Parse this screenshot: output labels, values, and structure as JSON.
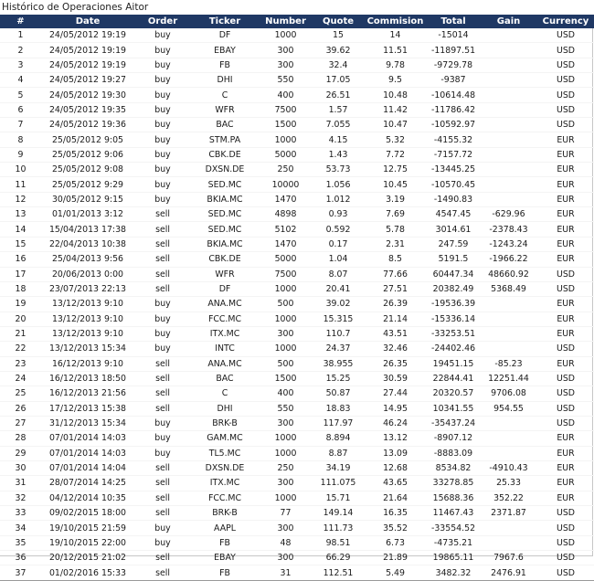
{
  "title": "Histórico de Operaciones Aitor",
  "columns": [
    "#",
    "Date",
    "Order",
    "Ticker",
    "Number",
    "Quote",
    "Commision",
    "Total",
    "Gain",
    "Currency"
  ],
  "rows": [
    [
      "1",
      "24/05/2012 19:19",
      "buy",
      "DF",
      "1000",
      "15",
      "14",
      "-15014",
      "",
      "USD"
    ],
    [
      "2",
      "24/05/2012 19:19",
      "buy",
      "EBAY",
      "300",
      "39.62",
      "11.51",
      "-11897.51",
      "",
      "USD"
    ],
    [
      "3",
      "24/05/2012 19:19",
      "buy",
      "FB",
      "300",
      "32.4",
      "9.78",
      "-9729.78",
      "",
      "USD"
    ],
    [
      "4",
      "24/05/2012 19:27",
      "buy",
      "DHI",
      "550",
      "17.05",
      "9.5",
      "-9387",
      "",
      "USD"
    ],
    [
      "5",
      "24/05/2012 19:30",
      "buy",
      "C",
      "400",
      "26.51",
      "10.48",
      "-10614.48",
      "",
      "USD"
    ],
    [
      "6",
      "24/05/2012 19:35",
      "buy",
      "WFR",
      "7500",
      "1.57",
      "11.42",
      "-11786.42",
      "",
      "USD"
    ],
    [
      "7",
      "24/05/2012 19:36",
      "buy",
      "BAC",
      "1500",
      "7.055",
      "10.47",
      "-10592.97",
      "",
      "USD"
    ],
    [
      "8",
      "25/05/2012 9:05",
      "buy",
      "STM.PA",
      "1000",
      "4.15",
      "5.32",
      "-4155.32",
      "",
      "EUR"
    ],
    [
      "9",
      "25/05/2012 9:06",
      "buy",
      "CBK.DE",
      "5000",
      "1.43",
      "7.72",
      "-7157.72",
      "",
      "EUR"
    ],
    [
      "10",
      "25/05/2012 9:08",
      "buy",
      "DXSN.DE",
      "250",
      "53.73",
      "12.75",
      "-13445.25",
      "",
      "EUR"
    ],
    [
      "11",
      "25/05/2012 9:29",
      "buy",
      "SED.MC",
      "10000",
      "1.056",
      "10.45",
      "-10570.45",
      "",
      "EUR"
    ],
    [
      "12",
      "30/05/2012 9:15",
      "buy",
      "BKIA.MC",
      "1470",
      "1.012",
      "3.19",
      "-1490.83",
      "",
      "EUR"
    ],
    [
      "13",
      "01/01/2013 3:12",
      "sell",
      "SED.MC",
      "4898",
      "0.93",
      "7.69",
      "4547.45",
      "-629.96",
      "EUR"
    ],
    [
      "14",
      "15/04/2013 17:38",
      "sell",
      "SED.MC",
      "5102",
      "0.592",
      "5.78",
      "3014.61",
      "-2378.43",
      "EUR"
    ],
    [
      "15",
      "22/04/2013 10:38",
      "sell",
      "BKIA.MC",
      "1470",
      "0.17",
      "2.31",
      "247.59",
      "-1243.24",
      "EUR"
    ],
    [
      "16",
      "25/04/2013 9:56",
      "sell",
      "CBK.DE",
      "5000",
      "1.04",
      "8.5",
      "5191.5",
      "-1966.22",
      "EUR"
    ],
    [
      "17",
      "20/06/2013 0:00",
      "sell",
      "WFR",
      "7500",
      "8.07",
      "77.66",
      "60447.34",
      "48660.92",
      "USD"
    ],
    [
      "18",
      "23/07/2013 22:13",
      "sell",
      "DF",
      "1000",
      "20.41",
      "27.51",
      "20382.49",
      "5368.49",
      "USD"
    ],
    [
      "19",
      "13/12/2013 9:10",
      "buy",
      "ANA.MC",
      "500",
      "39.02",
      "26.39",
      "-19536.39",
      "",
      "EUR"
    ],
    [
      "20",
      "13/12/2013 9:10",
      "buy",
      "FCC.MC",
      "1000",
      "15.315",
      "21.14",
      "-15336.14",
      "",
      "EUR"
    ],
    [
      "21",
      "13/12/2013 9:10",
      "buy",
      "ITX.MC",
      "300",
      "110.7",
      "43.51",
      "-33253.51",
      "",
      "EUR"
    ],
    [
      "22",
      "13/12/2013 15:34",
      "buy",
      "INTC",
      "1000",
      "24.37",
      "32.46",
      "-24402.46",
      "",
      "USD"
    ],
    [
      "23",
      "16/12/2013 9:10",
      "sell",
      "ANA.MC",
      "500",
      "38.955",
      "26.35",
      "19451.15",
      "-85.23",
      "EUR"
    ],
    [
      "24",
      "16/12/2013 18:50",
      "sell",
      "BAC",
      "1500",
      "15.25",
      "30.59",
      "22844.41",
      "12251.44",
      "USD"
    ],
    [
      "25",
      "16/12/2013 21:56",
      "sell",
      "C",
      "400",
      "50.87",
      "27.44",
      "20320.57",
      "9706.08",
      "USD"
    ],
    [
      "26",
      "17/12/2013 15:38",
      "sell",
      "DHI",
      "550",
      "18.83",
      "14.95",
      "10341.55",
      "954.55",
      "USD"
    ],
    [
      "27",
      "31/12/2013 15:34",
      "buy",
      "BRK-B",
      "300",
      "117.97",
      "46.24",
      "-35437.24",
      "",
      "USD"
    ],
    [
      "28",
      "07/01/2014 14:03",
      "buy",
      "GAM.MC",
      "1000",
      "8.894",
      "13.12",
      "-8907.12",
      "",
      "EUR"
    ],
    [
      "29",
      "07/01/2014 14:03",
      "buy",
      "TL5.MC",
      "1000",
      "8.87",
      "13.09",
      "-8883.09",
      "",
      "EUR"
    ],
    [
      "30",
      "07/01/2014 14:04",
      "sell",
      "DXSN.DE",
      "250",
      "34.19",
      "12.68",
      "8534.82",
      "-4910.43",
      "EUR"
    ],
    [
      "31",
      "28/07/2014 14:25",
      "sell",
      "ITX.MC",
      "300",
      "111.075",
      "43.65",
      "33278.85",
      "25.33",
      "EUR"
    ],
    [
      "32",
      "04/12/2014 10:35",
      "sell",
      "FCC.MC",
      "1000",
      "15.71",
      "21.64",
      "15688.36",
      "352.22",
      "EUR"
    ],
    [
      "33",
      "09/02/2015 18:00",
      "sell",
      "BRK-B",
      "77",
      "149.14",
      "16.35",
      "11467.43",
      "2371.87",
      "USD"
    ],
    [
      "34",
      "19/10/2015 21:59",
      "buy",
      "AAPL",
      "300",
      "111.73",
      "35.52",
      "-33554.52",
      "",
      "USD"
    ],
    [
      "35",
      "19/10/2015 22:00",
      "buy",
      "FB",
      "48",
      "98.51",
      "6.73",
      "-4735.21",
      "",
      "USD"
    ],
    [
      "36",
      "20/12/2015 21:02",
      "sell",
      "EBAY",
      "300",
      "66.29",
      "21.89",
      "19865.11",
      "7967.6",
      "USD"
    ],
    [
      "37",
      "01/02/2016 15:33",
      "sell",
      "FB",
      "31",
      "112.51",
      "5.49",
      "3482.32",
      "2476.91",
      "USD"
    ]
  ],
  "colors": {
    "header_bg": "#1f3864",
    "header_text": "#ffffff",
    "cell_text": "#1a1a1a"
  }
}
